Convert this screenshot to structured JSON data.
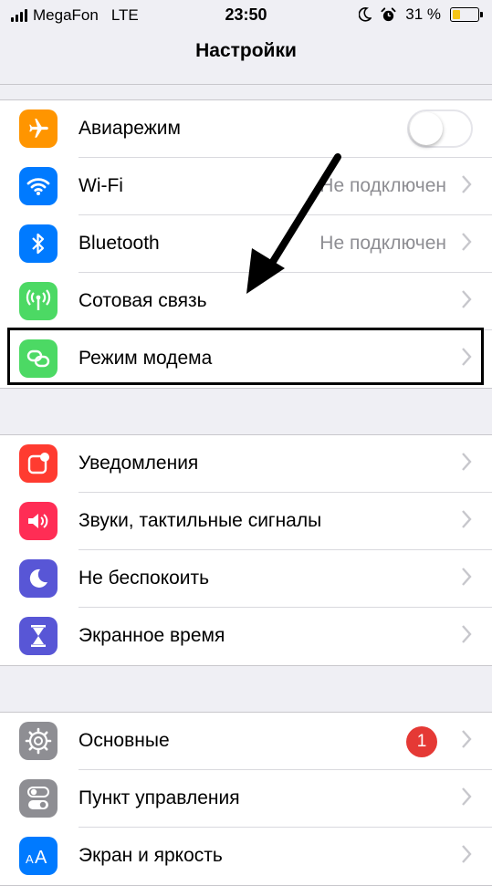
{
  "status_bar": {
    "carrier": "MegaFon",
    "network": "LTE",
    "time": "23:50",
    "battery_percent": "31 %",
    "battery_level": 0.31
  },
  "nav": {
    "title": "Настройки"
  },
  "groups": [
    {
      "items": [
        {
          "label": "Авиарежим",
          "icon": "airplane-icon",
          "color": "#ff9500",
          "control": "toggle",
          "toggle_on": false
        },
        {
          "label": "Wi-Fi",
          "icon": "wifi-icon",
          "color": "#007aff",
          "value": "Не подключен"
        },
        {
          "label": "Bluetooth",
          "icon": "bluetooth-icon",
          "color": "#007aff",
          "value": "Не подключен"
        },
        {
          "label": "Сотовая связь",
          "icon": "cellular-antenna-icon",
          "color": "#4cd964"
        },
        {
          "label": "Режим модема",
          "icon": "hotspot-chain-icon",
          "color": "#4cd964"
        }
      ]
    },
    {
      "items": [
        {
          "label": "Уведомления",
          "icon": "notifications-icon",
          "color": "#ff3b30"
        },
        {
          "label": "Звуки, тактильные сигналы",
          "icon": "speaker-icon",
          "color": "#ff2d55"
        },
        {
          "label": "Не беспокоить",
          "icon": "moon-icon",
          "color": "#5856d6"
        },
        {
          "label": "Экранное время",
          "icon": "hourglass-icon",
          "color": "#5856d6"
        }
      ]
    },
    {
      "items": [
        {
          "label": "Основные",
          "icon": "gear-icon",
          "color": "#8e8e93",
          "badge": "1"
        },
        {
          "label": "Пункт управления",
          "icon": "control-center-toggles-icon",
          "color": "#8e8e93"
        },
        {
          "label": "Экран и яркость",
          "icon": "text-size-aa-icon",
          "color": "#007aff"
        }
      ]
    }
  ]
}
